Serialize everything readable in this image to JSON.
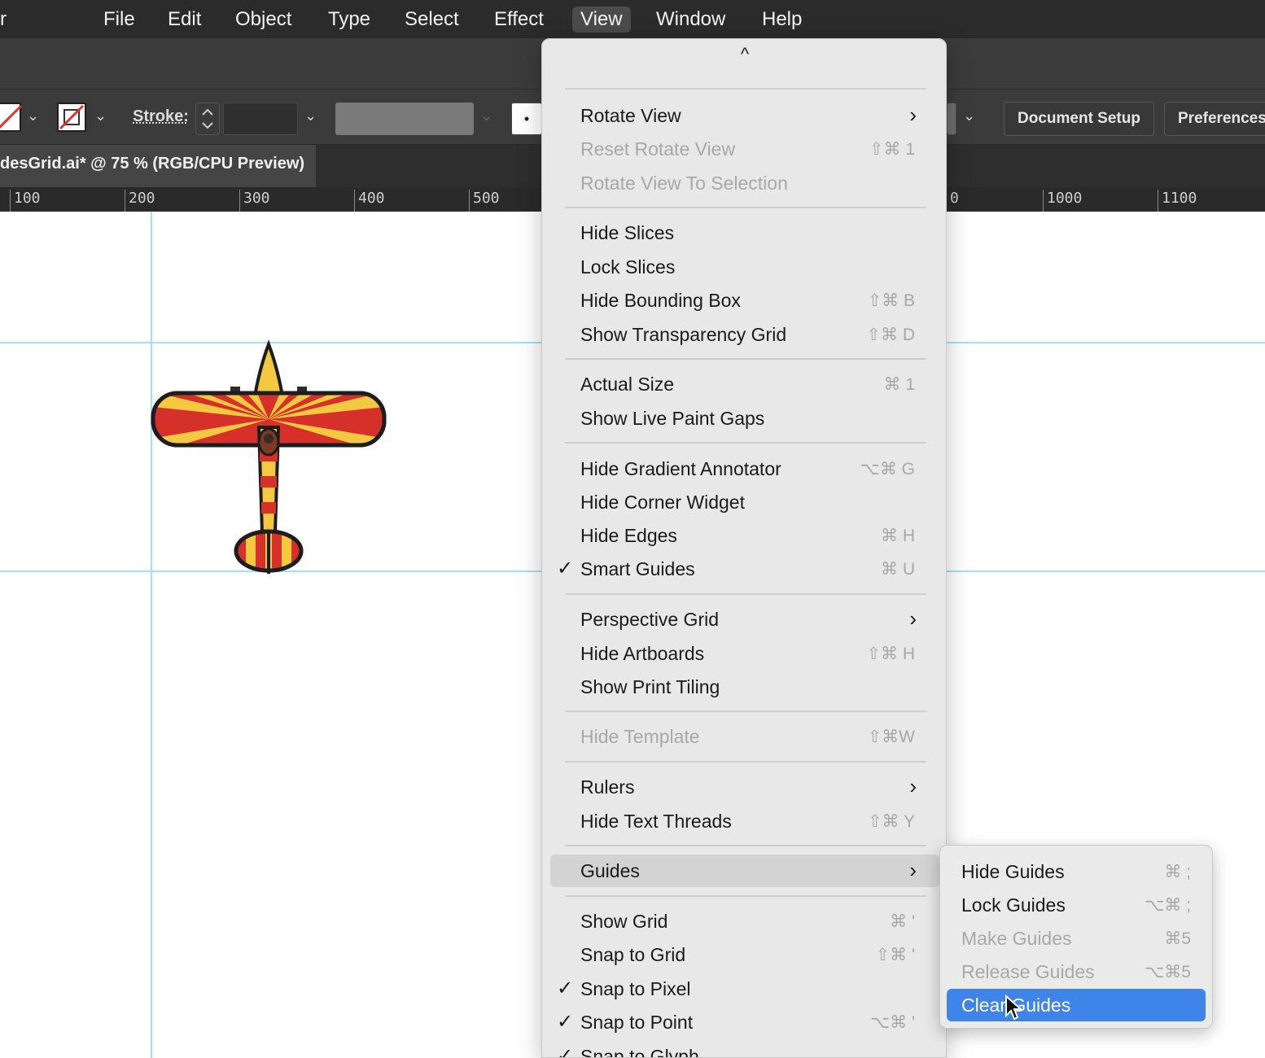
{
  "menubar": {
    "app_fragment": "r",
    "items": [
      "File",
      "Edit",
      "Object",
      "Type",
      "Select",
      "Effect",
      "View",
      "Window",
      "Help"
    ],
    "active": "View"
  },
  "control_bar": {
    "stroke_label": "Stroke:",
    "document_setup": "Document Setup",
    "preferences": "Preferences"
  },
  "document": {
    "tab_title": "desGrid.ai* @ 75 % (RGB/CPU Preview)"
  },
  "ruler": {
    "ticks": [
      "100",
      "200",
      "300",
      "400",
      "500",
      "0",
      "1000",
      "1100"
    ]
  },
  "view_menu": {
    "scroll_indicator": "^",
    "items": [
      {
        "label": "Rotate View",
        "shortcut": "",
        "submenu": true
      },
      {
        "label": "Reset Rotate View",
        "shortcut": "⇧⌘ 1",
        "disabled": true
      },
      {
        "label": "Rotate View To Selection",
        "shortcut": "",
        "disabled": true
      },
      {
        "label": "Hide Slices",
        "shortcut": ""
      },
      {
        "label": "Lock Slices",
        "shortcut": ""
      },
      {
        "label": "Hide Bounding Box",
        "shortcut": "⇧⌘ B"
      },
      {
        "label": "Show Transparency Grid",
        "shortcut": "⇧⌘ D"
      },
      {
        "label": "Actual Size",
        "shortcut": "⌘ 1"
      },
      {
        "label": "Show Live Paint Gaps",
        "shortcut": ""
      },
      {
        "label": "Hide Gradient Annotator",
        "shortcut": "⌥⌘ G"
      },
      {
        "label": "Hide Corner Widget",
        "shortcut": ""
      },
      {
        "label": "Hide Edges",
        "shortcut": "⌘ H"
      },
      {
        "label": "Smart Guides",
        "shortcut": "⌘ U",
        "checked": true
      },
      {
        "label": "Perspective Grid",
        "shortcut": "",
        "submenu": true
      },
      {
        "label": "Hide Artboards",
        "shortcut": "⇧⌘ H"
      },
      {
        "label": "Show Print Tiling",
        "shortcut": ""
      },
      {
        "label": "Hide Template",
        "shortcut": "⇧⌘W",
        "disabled": true
      },
      {
        "label": "Rulers",
        "shortcut": "",
        "submenu": true
      },
      {
        "label": "Hide Text Threads",
        "shortcut": "⇧⌘ Y"
      },
      {
        "label": "Guides",
        "shortcut": "",
        "submenu": true,
        "highlighted": true
      },
      {
        "label": "Show Grid",
        "shortcut": "⌘ '"
      },
      {
        "label": "Snap to Grid",
        "shortcut": "⇧⌘ '"
      },
      {
        "label": "Snap to Pixel",
        "shortcut": "",
        "checked": true
      },
      {
        "label": "Snap to Point",
        "shortcut": "⌥⌘ '",
        "checked": true
      },
      {
        "label": "Snap to Glyph",
        "shortcut": "",
        "checked": true
      }
    ]
  },
  "guides_submenu": {
    "items": [
      {
        "label": "Hide Guides",
        "shortcut": "⌘ ;"
      },
      {
        "label": "Lock Guides",
        "shortcut": "⌥⌘ ;"
      },
      {
        "label": "Make Guides",
        "shortcut": "⌘5",
        "disabled": true
      },
      {
        "label": "Release Guides",
        "shortcut": "⌥⌘5",
        "disabled": true
      },
      {
        "label": "Clear Guides",
        "shortcut": "",
        "selected": true
      }
    ]
  },
  "colors": {
    "menubar_bg": "#2b2b2b",
    "menu_bg": "#e8e8e8",
    "selection_blue": "#3f84e8",
    "guide_cyan": "#9be6ef",
    "plane_red": "#d5312a",
    "plane_yellow": "#f5c842"
  },
  "icons": {
    "check": "checkmark-icon",
    "submenu": "chevron-right-icon",
    "cursor": "mouse-pointer-icon"
  }
}
